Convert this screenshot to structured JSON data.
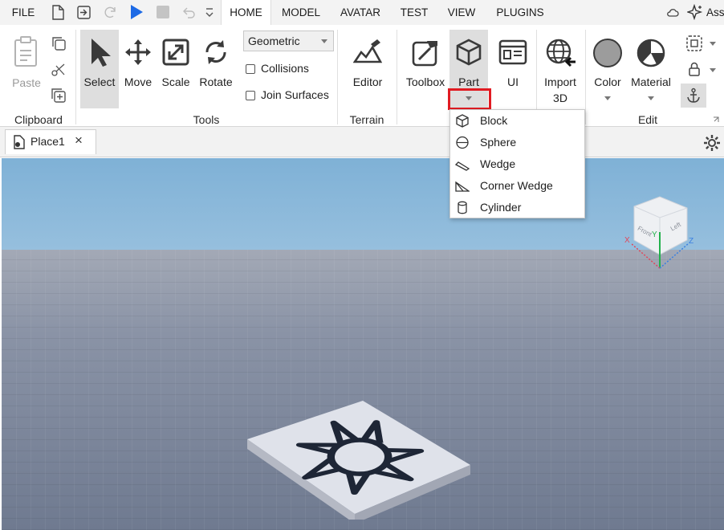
{
  "menubar": {
    "file": "FILE",
    "tabs": [
      "HOME",
      "MODEL",
      "AVATAR",
      "TEST",
      "VIEW",
      "PLUGINS"
    ],
    "active_tab": "HOME",
    "assistant_label": "Ass"
  },
  "ribbon": {
    "clipboard": {
      "paste": "Paste",
      "group": "Clipboard"
    },
    "tools": {
      "select": "Select",
      "move": "Move",
      "scale": "Scale",
      "rotate": "Rotate",
      "group": "Tools"
    },
    "transform_mode": {
      "selected": "Geometric"
    },
    "options": {
      "collisions": "Collisions",
      "join_surfaces": "Join Surfaces"
    },
    "terrain": {
      "editor": "Editor",
      "group": "Terrain"
    },
    "insert": {
      "toolbox": "Toolbox",
      "part": "Part",
      "ui": "UI",
      "import_line1": "Import",
      "import_line2": "3D"
    },
    "edit": {
      "color": "Color",
      "material": "Material",
      "group": "Edit"
    }
  },
  "document_tab": {
    "title": "Place1"
  },
  "part_menu": {
    "items": [
      {
        "label": "Block",
        "icon": "cube-icon"
      },
      {
        "label": "Sphere",
        "icon": "sphere-icon"
      },
      {
        "label": "Wedge",
        "icon": "wedge-icon"
      },
      {
        "label": "Corner Wedge",
        "icon": "corner-wedge-icon"
      },
      {
        "label": "Cylinder",
        "icon": "cylinder-icon"
      }
    ]
  },
  "view_cube": {
    "front": "Front",
    "left": "Left",
    "axis_x": "X",
    "axis_y": "Y",
    "axis_z": "Z"
  },
  "colors": {
    "highlight": "#e11b22",
    "play": "#1d6ae5",
    "select_active_bg": "#dedede"
  }
}
